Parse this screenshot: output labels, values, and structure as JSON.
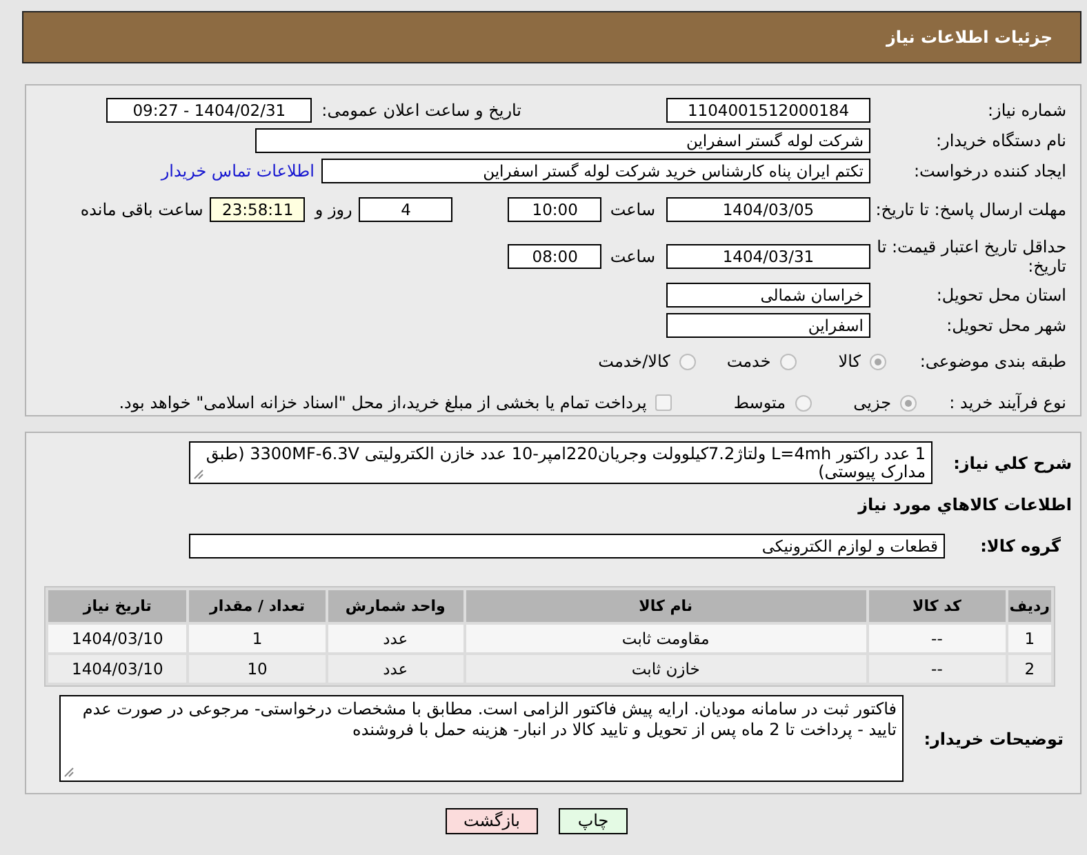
{
  "header": {
    "title": "جزئیات اطلاعات نیاز"
  },
  "need_info": {
    "need_number": {
      "label": "شماره نیاز:",
      "value": "1104001512000184"
    },
    "announce": {
      "label": "تاریخ و ساعت اعلان عمومی:",
      "value": "1404/02/31 - 09:27"
    },
    "buyer_org": {
      "label": "نام دستگاه خریدار:",
      "value": "شرکت لوله گستر اسفراین"
    },
    "requester": {
      "label": "ایجاد کننده درخواست:",
      "value": "تکتم ایران پناه کارشناس خرید شرکت لوله گستر اسفراین",
      "link": "اطلاعات تماس خریدار"
    },
    "reply_deadline": {
      "label": "مهلت ارسال پاسخ: تا تاریخ:",
      "date": "1404/03/05",
      "time_label": "ساعت",
      "time": "10:00",
      "days": "4",
      "days_label": "روز و",
      "remaining": "23:58:11",
      "remaining_label": "ساعت باقی مانده"
    },
    "price_validity": {
      "label": "حداقل تاریخ اعتبار قیمت: تا تاریخ:",
      "date": "1404/03/31",
      "time_label": "ساعت",
      "time": "08:00"
    },
    "province": {
      "label": "استان محل تحویل:",
      "value": "خراسان شمالی"
    },
    "city": {
      "label": "شهر محل تحویل:",
      "value": "اسفراین"
    },
    "category": {
      "label": "طبقه بندی موضوعی:",
      "options": [
        {
          "label": "کالا",
          "selected": true
        },
        {
          "label": "خدمت",
          "selected": false
        },
        {
          "label": "کالا/خدمت",
          "selected": false
        }
      ]
    },
    "purchase_process": {
      "label": "نوع فرآیند خرید :",
      "options": [
        {
          "label": "جزیی",
          "selected": true
        },
        {
          "label": "متوسط",
          "selected": false
        }
      ],
      "treasury_payment": {
        "label": "پرداخت تمام یا بخشی از مبلغ خرید،از محل \"اسناد خزانه اسلامی\" خواهد بود.",
        "checked": false
      }
    }
  },
  "items_section": {
    "description": {
      "label": "شرح کلي نياز:",
      "value": "1 عدد راکتور L=4mh ولتاژ7.2کیلوولت وجریان220امپر-10 عدد خازن الکترولیتی 3300MF-6.3V (طبق مدارک پیوستی)"
    },
    "heading": "اطلاعات کالاهاي مورد نياز",
    "goods_group": {
      "label": "گروه کالا:",
      "value": "قطعات و لوازم الکترونیکی"
    },
    "table": {
      "columns": [
        "ردیف",
        "کد کالا",
        "نام کالا",
        "واحد شمارش",
        "تعداد / مقدار",
        "تاریخ نیاز"
      ],
      "rows": [
        [
          "1",
          "--",
          "مقاومت ثابت",
          "عدد",
          "1",
          "1404/03/10"
        ],
        [
          "2",
          "--",
          "خازن ثابت",
          "عدد",
          "10",
          "1404/03/10"
        ]
      ]
    },
    "buyer_notes": {
      "label": "توضیحات خریدار:",
      "value": "فاکتور ثبت در سامانه مودیان. ارایه پیش فاکتور الزامی است. مطابق با مشخصات درخواستی- مرجوعی در صورت عدم تایید - پرداخت تا 2 ماه پس از تحویل و تایید کالا در انبار- هزینه حمل با فروشنده"
    }
  },
  "buttons": [
    {
      "label": "چاپ",
      "kind": "print"
    },
    {
      "label": "بازگشت",
      "kind": "back"
    }
  ]
}
